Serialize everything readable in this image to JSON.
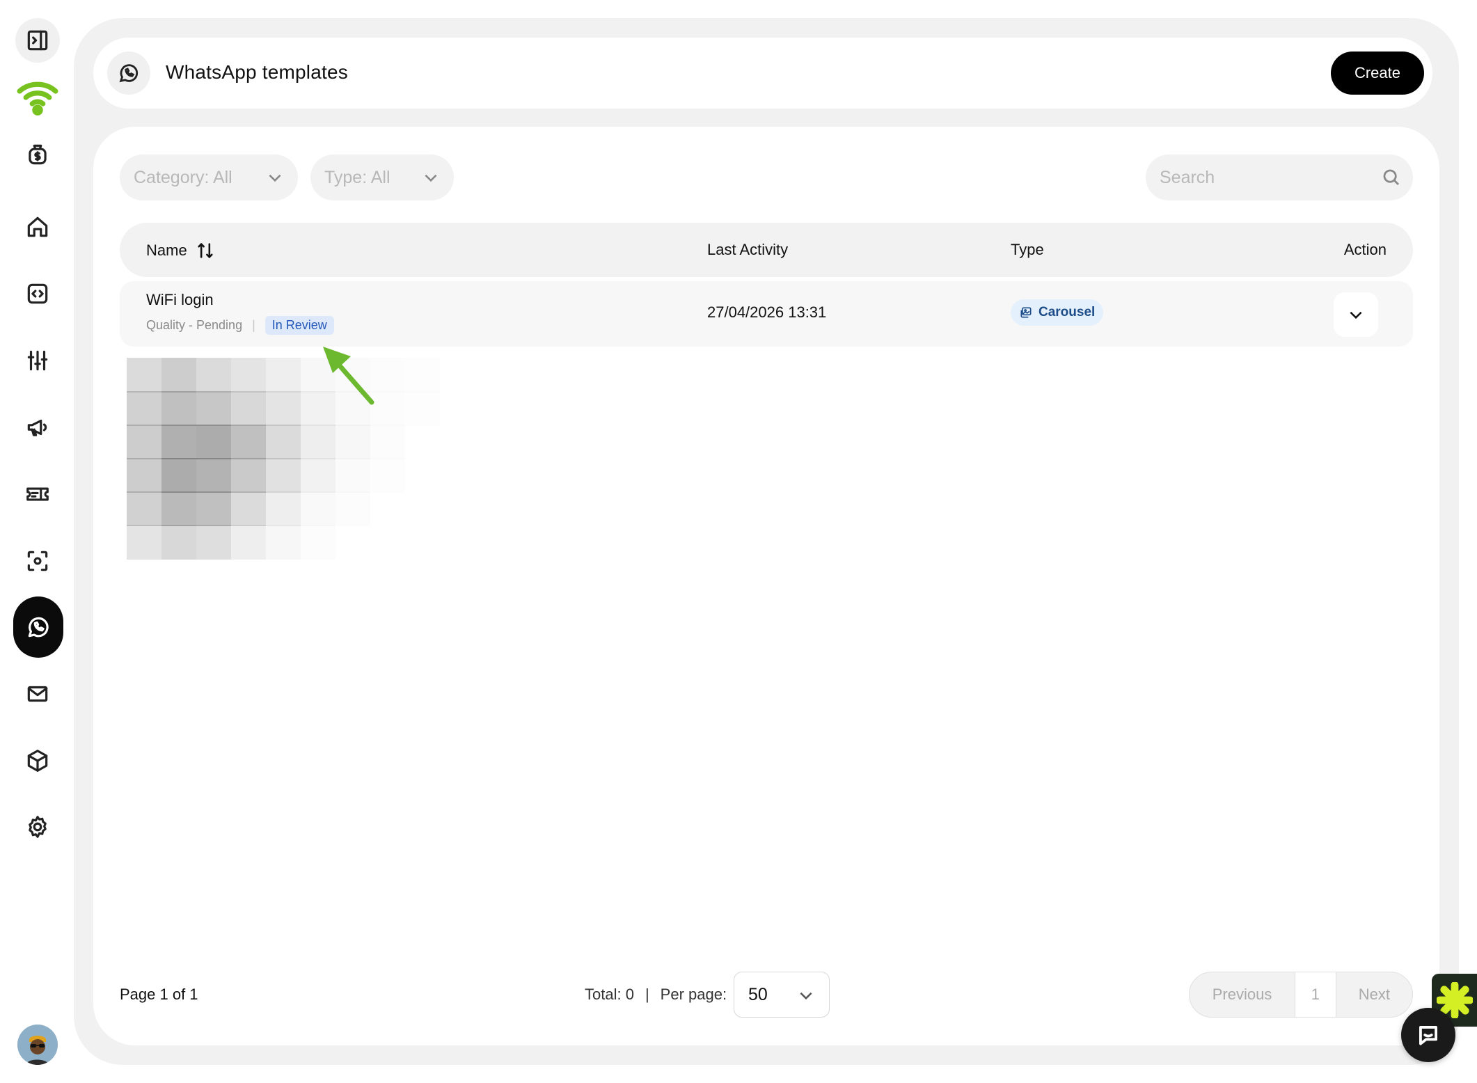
{
  "header": {
    "title": "WhatsApp templates",
    "create_label": "Create"
  },
  "sidebar": {
    "items": [
      {
        "name": "sidebar-toggle",
        "icon": "sidebar-toggle-icon"
      },
      {
        "name": "brand-logo",
        "icon": "wifi-logo-icon",
        "color": "#77c21f"
      },
      {
        "name": "billing",
        "icon": "dollar-bag-icon"
      },
      {
        "name": "home",
        "icon": "home-icon"
      },
      {
        "name": "code",
        "icon": "code-icon"
      },
      {
        "name": "controls",
        "icon": "sliders-icon"
      },
      {
        "name": "campaigns",
        "icon": "megaphone-icon"
      },
      {
        "name": "vouchers",
        "icon": "ticket-icon"
      },
      {
        "name": "scan",
        "icon": "scan-icon"
      },
      {
        "name": "whatsapp",
        "icon": "whatsapp-icon",
        "active": true
      },
      {
        "name": "email",
        "icon": "mail-icon"
      },
      {
        "name": "products",
        "icon": "cube-icon"
      },
      {
        "name": "settings",
        "icon": "gear-icon"
      }
    ]
  },
  "filters": {
    "category_label": "Category: All",
    "type_label": "Type: All",
    "search_placeholder": "Search"
  },
  "table": {
    "columns": {
      "name": "Name",
      "last_activity": "Last Activity",
      "type": "Type",
      "action": "Action"
    },
    "rows": [
      {
        "name": "WiFi login",
        "quality": "Quality - Pending",
        "separator": "|",
        "status": "In Review",
        "last_activity": "27/04/2026 13:31",
        "type": "Carousel"
      }
    ]
  },
  "footer": {
    "page_text": "Page 1 of 1",
    "total_text": "Total: 0",
    "divider": "|",
    "per_page_label": "Per page:",
    "per_page_value": "50",
    "previous_label": "Previous",
    "current_page": "1",
    "next_label": "Next"
  },
  "colors": {
    "accent": "#000000",
    "annotation_arrow": "#6cb82f",
    "review_badge_bg": "#dde9fb",
    "type_badge_bg": "#e4f0fb"
  }
}
